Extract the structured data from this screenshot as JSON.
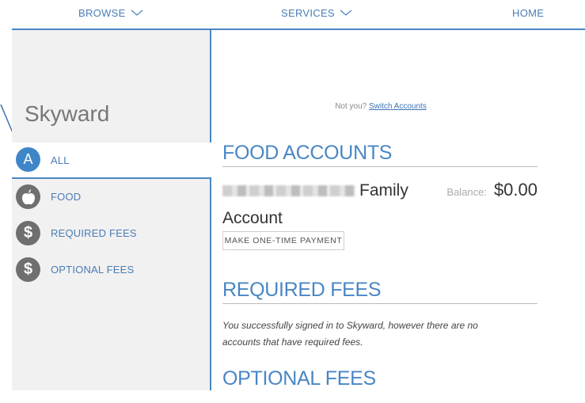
{
  "nav": {
    "browse": "BROWSE",
    "services": "SERVICES",
    "home": "HOME"
  },
  "sidebar": {
    "brand": "Skyward",
    "items": [
      {
        "label": "ALL",
        "icon": "letter-a-icon",
        "glyph": "A",
        "active": true
      },
      {
        "label": "FOOD",
        "icon": "apple-icon",
        "active": false
      },
      {
        "label": "REQUIRED FEES",
        "icon": "dollar-icon",
        "glyph": "$",
        "active": false
      },
      {
        "label": "OPTIONAL FEES",
        "icon": "dollar-icon",
        "glyph": "$",
        "active": false
      }
    ]
  },
  "main": {
    "not_you": "Not you?",
    "switch_accounts": "Switch Accounts",
    "food_accounts_title": "FOOD ACCOUNTS",
    "account": {
      "name_suffix": "Family",
      "name_line2": "Account",
      "balance_label": "Balance:",
      "balance_value": "$0.00",
      "pay_button": "MAKE ONE-TIME PAYMENT"
    },
    "required_fees_title": "REQUIRED FEES",
    "required_fees_message": "You successfully signed in to Skyward, however there are no accounts that have required fees.",
    "optional_fees_title": "OPTIONAL FEES"
  },
  "colors": {
    "accent": "#4a86c5",
    "link": "#4a7db6",
    "active_icon": "#3f86c8",
    "inactive_icon": "#6f6f6f",
    "sidebar_bg": "#f1f1f1"
  }
}
